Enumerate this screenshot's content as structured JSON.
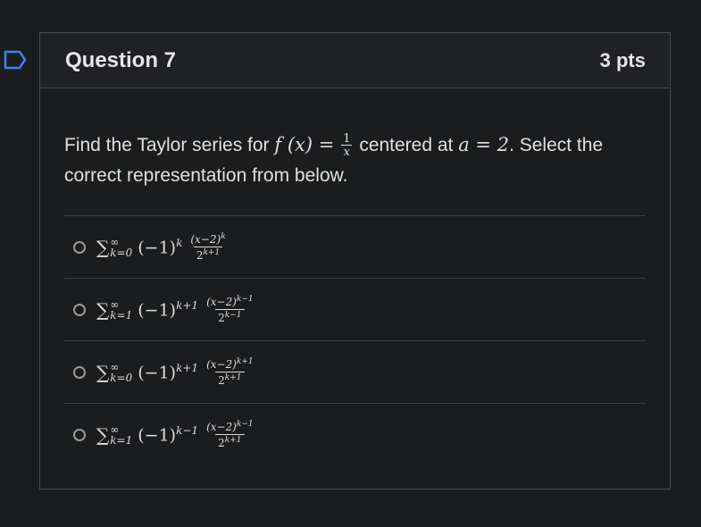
{
  "question": {
    "title": "Question 7",
    "points": "3 pts",
    "text_before": "Find the Taylor series for",
    "function_lhs": "f (x) =",
    "function_num": "1",
    "function_den": "x",
    "text_middle": "centered at",
    "center_expr": "a = 2",
    "text_after": ". Select the correct representation from below."
  },
  "answers": [
    {
      "lower": "k=0",
      "upper": "∞",
      "sign_exp": "k",
      "num_exp": "k",
      "den_exp": "k+1"
    },
    {
      "lower": "k=1",
      "upper": "∞",
      "sign_exp": "k+1",
      "num_exp": "k−1",
      "den_exp": "k−1"
    },
    {
      "lower": "k=0",
      "upper": "∞",
      "sign_exp": "k+1",
      "num_exp": "k+1",
      "den_exp": "k+1"
    },
    {
      "lower": "k=1",
      "upper": "∞",
      "sign_exp": "k−1",
      "num_exp": "k−1",
      "den_exp": "k+1"
    }
  ],
  "common": {
    "sigma": "∑",
    "sign_base": "(−1)",
    "num_base": "(x−2)",
    "den_base": "2"
  },
  "icons": {
    "flag": "bookmark-flag-icon",
    "accent": "#3b82f6"
  }
}
